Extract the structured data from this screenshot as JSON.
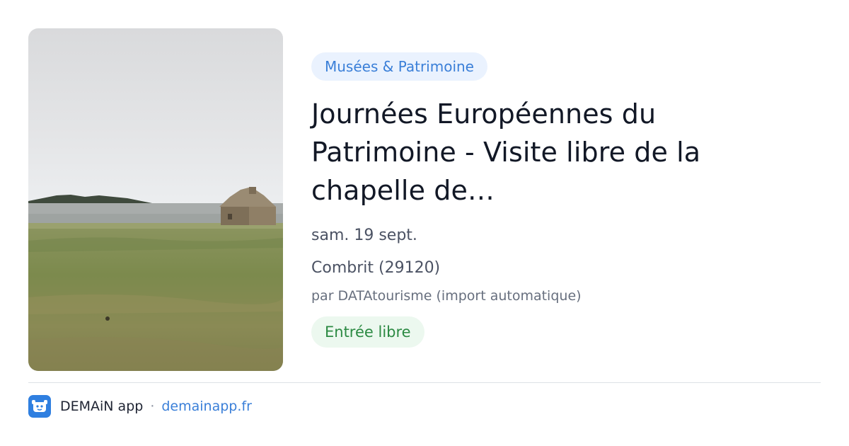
{
  "preview": {
    "image": {
      "description_icon": "landscape-photo"
    },
    "category": "Musées & Patrimoine",
    "title": "Journées Européennes du Patrimoine - Visite libre de la chapelle de…",
    "date": "sam. 19 sept.",
    "location": "Combrit (29120)",
    "organizer": "par DATAtourisme (import automatique)",
    "price": "Entrée libre"
  },
  "footer": {
    "app_icon": "demain-app-icon",
    "app_name": "DEMAiN app",
    "separator": "·",
    "site": "demainapp.fr"
  },
  "colors": {
    "category_bg": "#eaf2fe",
    "category_text": "#3a7fd8",
    "price_bg": "#ecf8ef",
    "price_text": "#2c8a43",
    "app_icon_bg": "#2f7fe0"
  }
}
